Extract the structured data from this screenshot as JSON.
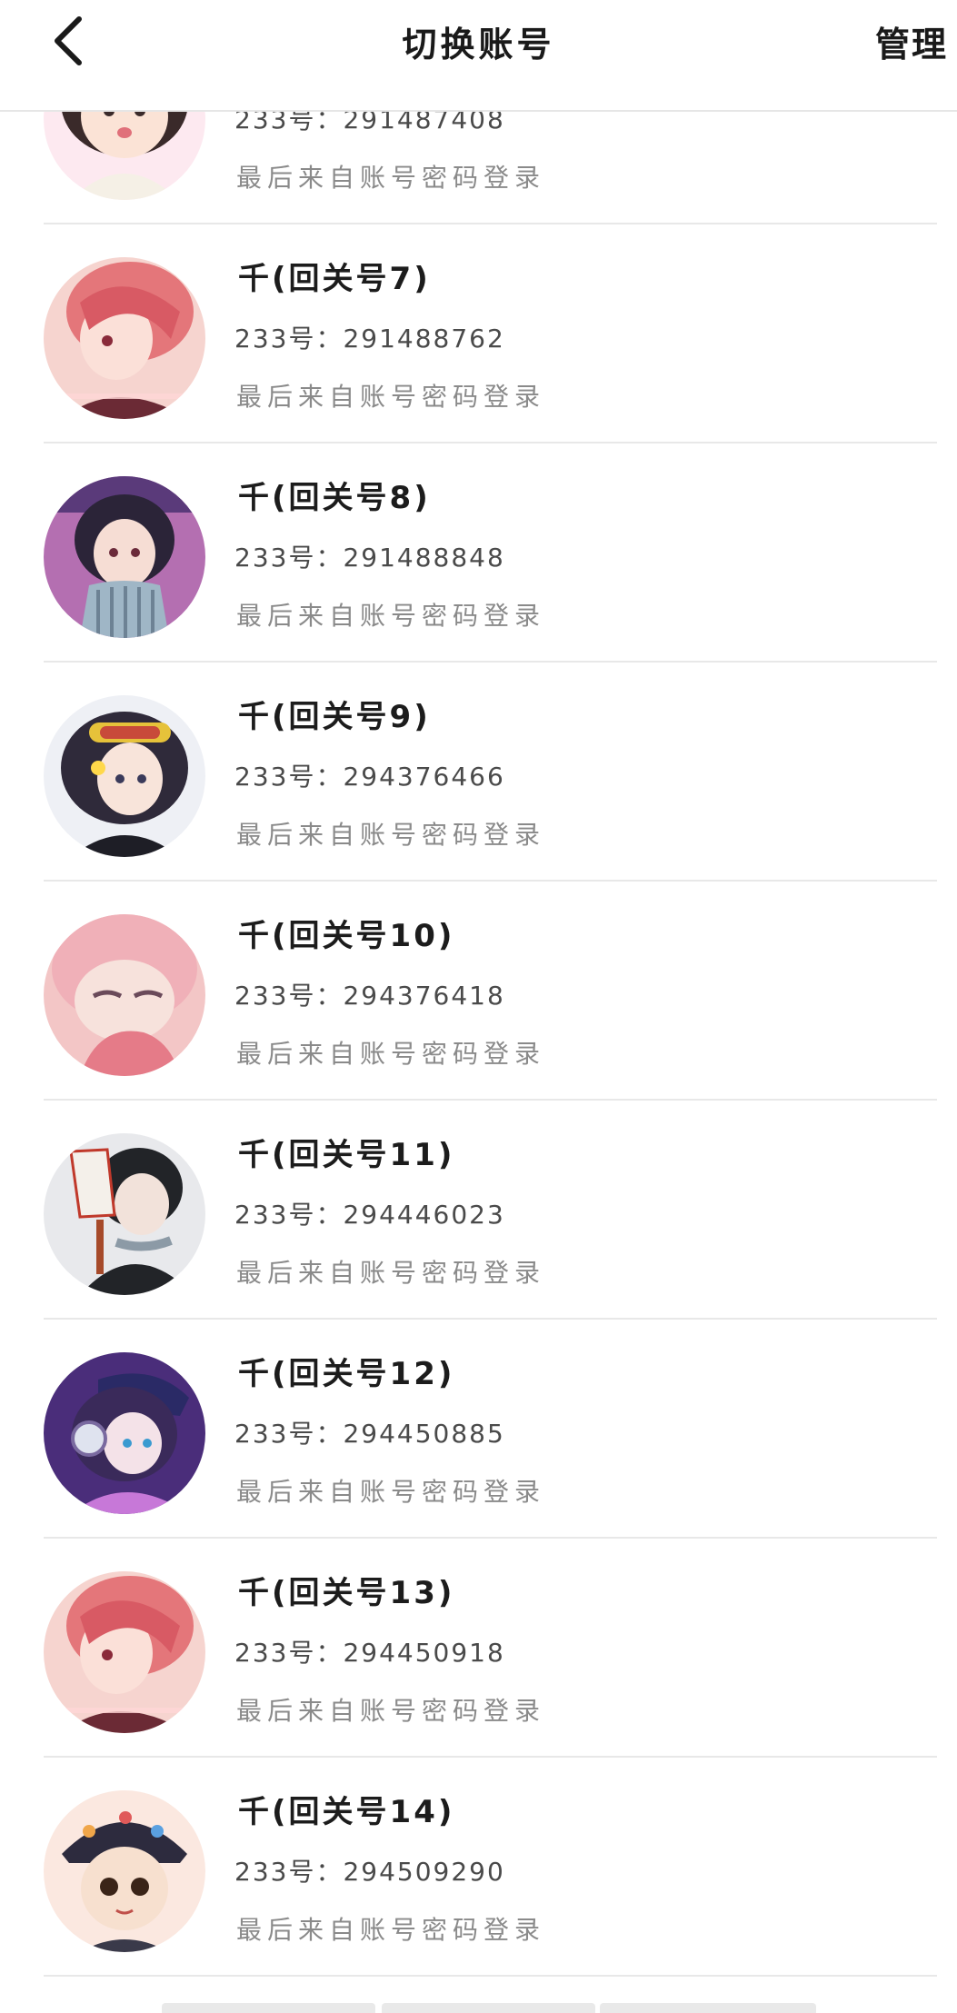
{
  "header": {
    "title": "切换账号",
    "manage_label": "管理"
  },
  "accounts": [
    {
      "name": "",
      "uid": "233号：291487408",
      "login_method": "最后来自账号密码登录",
      "avatar": "anime-girl-white-hood",
      "colors": [
        "#fde9f0",
        "#f5f0e6",
        "#3a2a2a"
      ]
    },
    {
      "name": "千(回关号7)",
      "uid": "233号：291488762",
      "login_method": "最后来自账号密码登录",
      "avatar": "anime-boy-pink-hair",
      "colors": [
        "#f6d4cf",
        "#e4767a",
        "#6b2a35"
      ]
    },
    {
      "name": "千(回关号8)",
      "uid": "233号：291488848",
      "login_method": "最后来自账号密码登录",
      "avatar": "anime-girl-striped-shirt",
      "colors": [
        "#b46fb1",
        "#4b3f6e",
        "#9fb6c6"
      ]
    },
    {
      "name": "千(回关号9)",
      "uid": "233号：294376466",
      "login_method": "最后来自账号密码登录",
      "avatar": "anime-girl-goggles",
      "colors": [
        "#eef0f5",
        "#2f2a3a",
        "#e6c23a"
      ]
    },
    {
      "name": "千(回关号10)",
      "uid": "233号：294376418",
      "login_method": "最后来自账号密码登录",
      "avatar": "anime-girl-pink-hair",
      "colors": [
        "#f3c6c6",
        "#e57b88",
        "#f7e2dc"
      ]
    },
    {
      "name": "千(回关号11)",
      "uid": "233号：294446023",
      "login_method": "最后来自账号密码登录",
      "avatar": "anime-boy-fox-mask",
      "colors": [
        "#e8e9ec",
        "#222428",
        "#a64a2a"
      ]
    },
    {
      "name": "千(回关号12)",
      "uid": "233号：294450885",
      "login_method": "最后来自账号密码登录",
      "avatar": "anime-girl-headphones",
      "colors": [
        "#4a2d7a",
        "#2a2a66",
        "#c778d8"
      ]
    },
    {
      "name": "千(回关号13)",
      "uid": "233号：294450918",
      "login_method": "最后来自账号密码登录",
      "avatar": "anime-boy-pink-hair",
      "colors": [
        "#f6d4cf",
        "#e4767a",
        "#6b2a35"
      ]
    },
    {
      "name": "千(回关号14)",
      "uid": "233号：294509290",
      "login_method": "最后来自账号密码登录",
      "avatar": "chibi-girl-floral-hat",
      "colors": [
        "#fbe8e0",
        "#2d2b3e",
        "#f0a64a"
      ]
    }
  ]
}
